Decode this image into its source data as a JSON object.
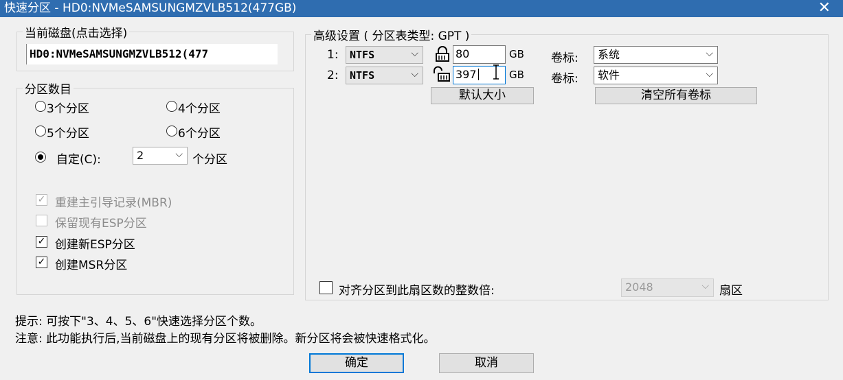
{
  "window": {
    "title": "快速分区 - HD0:NVMeSAMSUNGMZVLB512(477GB)",
    "close_glyph": "✕"
  },
  "disk_group": {
    "legend": "当前磁盘(点击选择)",
    "value": "HD0:NVMeSAMSUNGMZVLB512(477"
  },
  "count_group": {
    "legend": "分区数目",
    "options": {
      "three": "3个分区",
      "four": "4个分区",
      "five": "5个分区",
      "six": "6个分区"
    },
    "custom_label": "自定(C):",
    "custom_value": "2",
    "custom_suffix": "个分区",
    "selected": "custom"
  },
  "checks": {
    "rebuild_mbr": {
      "label": "重建主引导记录(MBR)",
      "checked": true,
      "enabled": false
    },
    "keep_esp": {
      "label": "保留现有ESP分区",
      "checked": false,
      "enabled": false
    },
    "create_esp": {
      "label": "创建新ESP分区",
      "checked": true,
      "enabled": true
    },
    "create_msr": {
      "label": "创建MSR分区",
      "checked": true,
      "enabled": true
    }
  },
  "advanced": {
    "legend": "高级设置 ( 分区表类型: GPT )",
    "rows": [
      {
        "index": "1:",
        "fs": "NTFS",
        "size": "80",
        "unit": "GB",
        "label_caption": "卷标:",
        "label_value": "系统",
        "lock": "locked"
      },
      {
        "index": "2:",
        "fs": "NTFS",
        "size": "397",
        "unit": "GB",
        "label_caption": "卷标:",
        "label_value": "软件",
        "lock": "unlocked"
      }
    ],
    "default_size_button": "默认大小",
    "clear_labels_button": "清空所有卷标",
    "align_label": "对齐分区到此扇区数的整数倍:",
    "align_value": "2048",
    "align_suffix": "扇区"
  },
  "tips": {
    "hint": "提示: 可按下\"3、4、5、6\"快速选择分区个数。",
    "warning": "注意: 此功能执行后,当前磁盘上的现有分区将被删除。新分区将会被快速格式化。"
  },
  "buttons": {
    "ok": "确定",
    "cancel": "取消"
  },
  "icons": {
    "chevron": "⌵",
    "check": "✓"
  }
}
